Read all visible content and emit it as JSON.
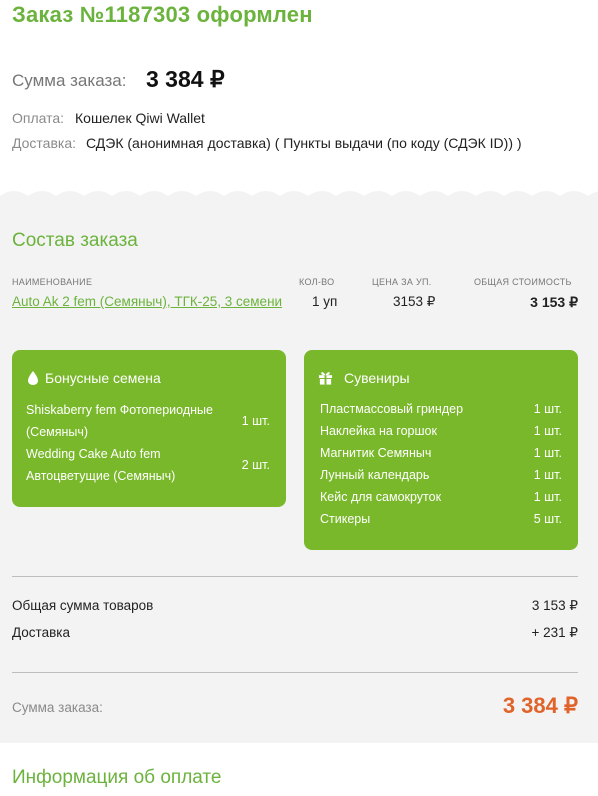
{
  "header": {
    "title": "Заказ №1187303 оформлен"
  },
  "summary": {
    "sum_label": "Сумма заказа:",
    "sum_value": "3 384 ₽",
    "payment_label": "Оплата:",
    "payment_value": "Кошелек Qiwi Wallet",
    "delivery_label": "Доставка:",
    "delivery_value": "СДЭК (анонимная доставка) ( Пункты выдачи (по коду (СДЭК ID)) )"
  },
  "order": {
    "title": "Состав заказа",
    "columns": [
      "НАИМЕНОВАНИЕ",
      "КОЛ-ВО",
      "ЦЕНА ЗА УП.",
      "ОБЩАЯ СТОИМОСТЬ"
    ],
    "rows": [
      {
        "name": "Auto Ak 2 fem (Семяныч), ТГК-25, 3 семени",
        "qty": "1 уп",
        "price": "3153 ₽",
        "total": "3 153 ₽"
      }
    ]
  },
  "bonus": {
    "title": "Бонусные семена",
    "icon": "seed-drop-icon",
    "items": [
      {
        "name_line1": "Shiskaberry fem Фотопериодные",
        "name_line2": "(Семяныч)",
        "qty": "1 шт."
      },
      {
        "name_line1": "Wedding Cake Auto fem",
        "name_line2": "Автоцветущие (Семяныч)",
        "qty": "2 шт."
      }
    ]
  },
  "souvenirs": {
    "title": "Сувениры",
    "icon": "gift-icon",
    "items": [
      {
        "name": "Пластмассовый гриндер",
        "qty": "1 шт."
      },
      {
        "name": "Наклейка на горшок",
        "qty": "1 шт."
      },
      {
        "name": "Магнитик Семяныч",
        "qty": "1 шт."
      },
      {
        "name": "Лунный календарь",
        "qty": "1 шт."
      },
      {
        "name": "Кейс для самокруток",
        "qty": "1 шт."
      },
      {
        "name": "Стикеры",
        "qty": "5 шт."
      }
    ]
  },
  "totals": {
    "goods_label": "Общая сумма товаров",
    "goods_value": "3 153 ₽",
    "delivery_label": "Доставка",
    "delivery_value": "+ 231 ₽",
    "final_label": "Сумма заказа:",
    "final_value": "3 384 ₽"
  },
  "payment_info": {
    "title": "Информация об оплате"
  },
  "colors": {
    "accent": "#6cb33e",
    "card": "#79b82a",
    "total": "#e0632a"
  }
}
